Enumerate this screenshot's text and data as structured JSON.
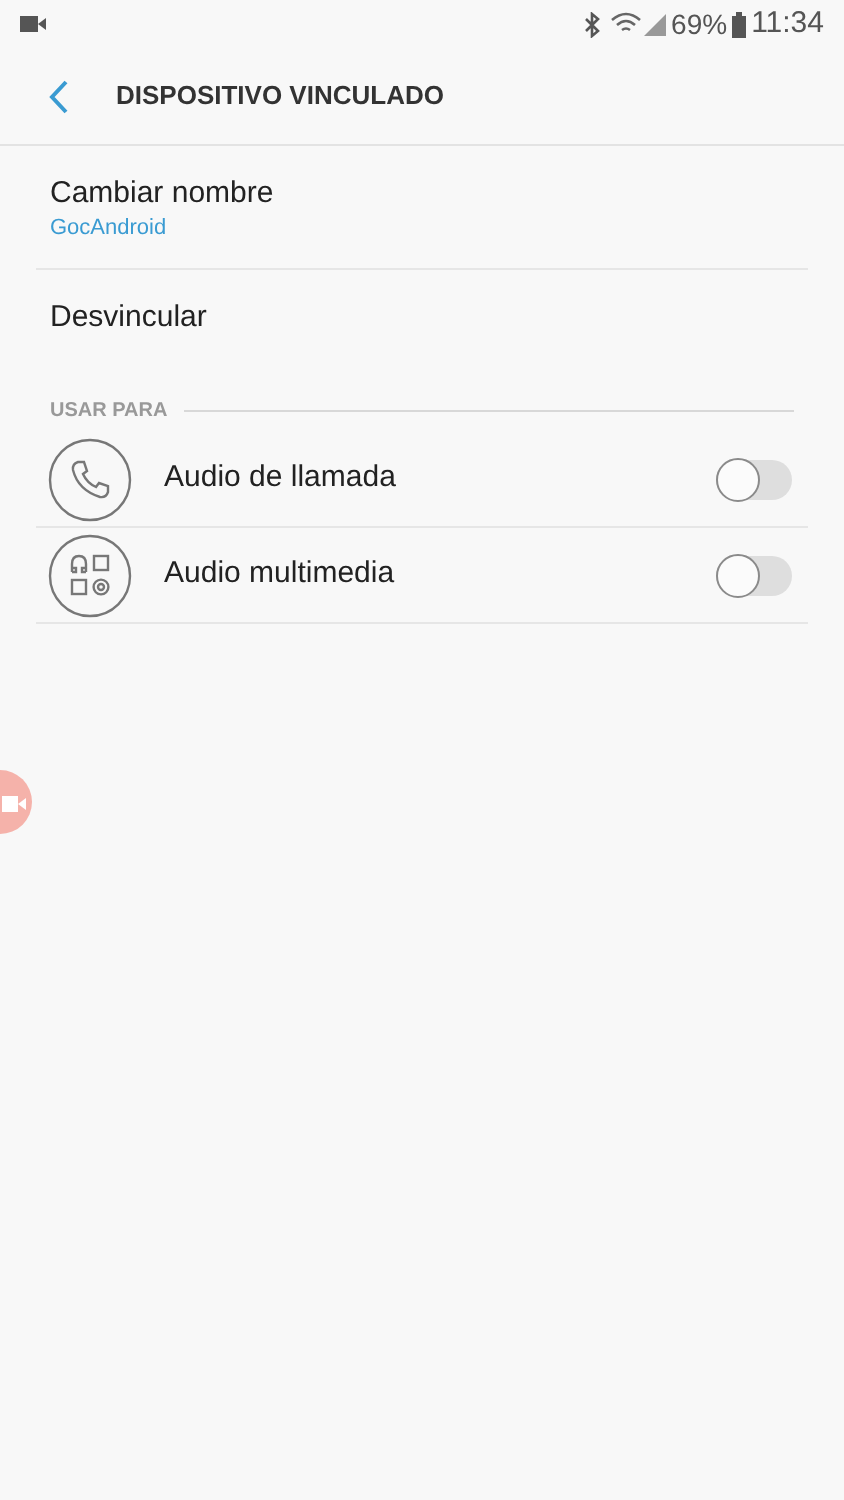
{
  "status_bar": {
    "battery": "69%",
    "time": "11:34"
  },
  "header": {
    "title": "DISPOSITIVO VINCULADO"
  },
  "rename": {
    "label": "Cambiar nombre",
    "value": "GocAndroid"
  },
  "unpair": {
    "label": "Desvincular"
  },
  "section": {
    "title": "USAR PARA"
  },
  "profiles": [
    {
      "kind": "call",
      "label": "Audio de llamada",
      "on": false
    },
    {
      "kind": "media",
      "label": "Audio multimedia",
      "on": false
    }
  ]
}
